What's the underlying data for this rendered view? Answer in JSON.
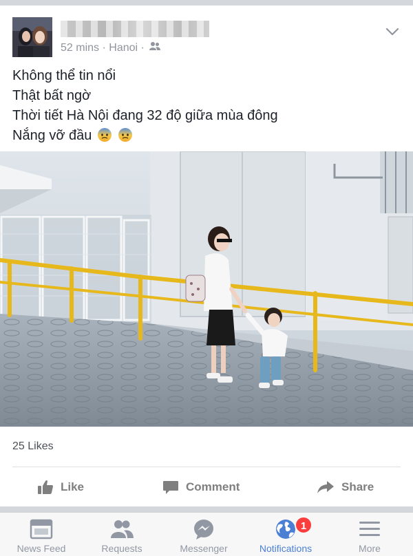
{
  "post": {
    "author_name_redacted": "",
    "meta": {
      "time": "52 mins",
      "separator": "·",
      "location": "Hanoi",
      "separator2": "·",
      "audience_icon": "friends-icon"
    },
    "text_lines": [
      "Không thể tin nổi",
      "Thật bất ngờ",
      "Thời tiết Hà Nội đang 32 độ giữa mùa đông",
      "Nắng vỡ đầu"
    ],
    "emoji": "anxious-face-with-sweat",
    "likes": "25 Likes",
    "actions": {
      "like": "Like",
      "comment": "Comment",
      "share": "Share"
    }
  },
  "tabbar": {
    "tabs": [
      {
        "label": "News Feed",
        "icon": "news-feed-icon",
        "active": false
      },
      {
        "label": "Requests",
        "icon": "requests-icon",
        "active": false
      },
      {
        "label": "Messenger",
        "icon": "messenger-icon",
        "active": false
      },
      {
        "label": "Notifications",
        "icon": "globe-icon",
        "active": true
      },
      {
        "label": "More",
        "icon": "menu-icon",
        "active": false
      }
    ],
    "notification_badge": "1"
  },
  "colors": {
    "accent": "#4a7fd4",
    "badge": "#fa3e3e",
    "inactive": "#9197a3",
    "railing": "#e7b81c"
  }
}
